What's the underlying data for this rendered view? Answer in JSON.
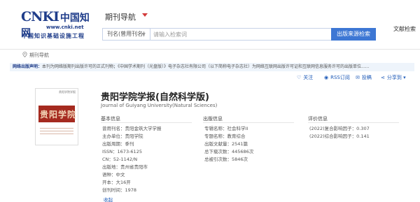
{
  "header": {
    "logo_mark": "CNKI",
    "logo_cn": "中国知网",
    "logo_url": "www.cnki.net",
    "logo_sub": "中国知识基础设施工程",
    "nav_title": "期刊导航",
    "help_link": "文献检索"
  },
  "search": {
    "field_label": "刊名(曾用刊名)",
    "placeholder": "请输入检索词",
    "button_label": "出版来源检索"
  },
  "breadcrumb": {
    "label": "期刊导航"
  },
  "notice": {
    "lead": "网络出版声明：",
    "text": "本刊为网络版期刊出版许可的正式刊物；《中国学术期刊（光盘版）》电子杂志社有限公司（以下简称电子杂志社）为网络互联网出版许可证和互联网信息服务许可的出版单位......"
  },
  "actions": [
    {
      "icon": "heart-icon",
      "glyph": "♡",
      "label": "关注",
      "name": "follow-button"
    },
    {
      "icon": "rss-icon",
      "glyph": "◉",
      "label": "RSS订阅",
      "name": "rss-subscribe-button"
    },
    {
      "icon": "submit-icon",
      "glyph": "✉",
      "label": "投稿",
      "name": "submit-button"
    },
    {
      "icon": "share-icon",
      "glyph": "⋖",
      "label": "分享到 ▾",
      "name": "share-button"
    }
  ],
  "journal": {
    "cover_text": "贵阳学院",
    "cover_top": "贵阳学院学报",
    "title": "贵阳学院学报(自然科学版)",
    "title_en": "Journal of Guiyang University(Natural Sciences)"
  },
  "basic": {
    "heading": "基本信息",
    "items": [
      {
        "label": "曾用刊名：",
        "value": "贵阳金筑大学学报"
      },
      {
        "label": "主办单位：",
        "value": "贵阳学院"
      },
      {
        "label": "出版周期：",
        "value": "季刊"
      },
      {
        "label": "ISSN：",
        "value": "1673-6125"
      },
      {
        "label": "CN：",
        "value": "52-1142/N"
      },
      {
        "label": "出版地：",
        "value": "贵州省贵阳市"
      },
      {
        "label": "语种：",
        "value": "中文"
      },
      {
        "label": "开本：",
        "value": "大16开"
      },
      {
        "label": "创刊时间：",
        "value": "1978"
      }
    ],
    "more": "收起"
  },
  "publish": {
    "heading": "出版信息",
    "items": [
      {
        "label": "专辑名称：",
        "value": "社会科学II"
      },
      {
        "label": "专题名称：",
        "value": "教育综合"
      },
      {
        "label": "出版文献量：",
        "value": "2541篇"
      },
      {
        "label": "总下载次数：",
        "value": "445686次"
      },
      {
        "label": "总被引次数：",
        "value": "5846次"
      }
    ]
  },
  "evaluation": {
    "heading": "评价信息",
    "items": [
      {
        "label": "(2022)复合影响因子：",
        "value": "0.307"
      },
      {
        "label": "(2022)综合影响因子：",
        "value": "0.141"
      }
    ]
  },
  "colors": {
    "accent": "#3d77d4",
    "link": "#1f5bb8",
    "logo": "#1f3d8a",
    "cover": "#a52a1f"
  }
}
